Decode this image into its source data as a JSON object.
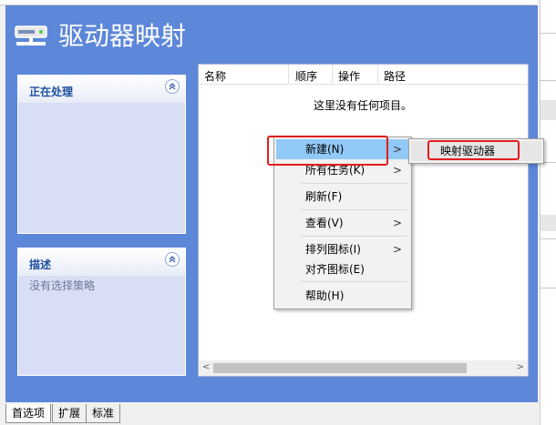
{
  "header": {
    "title": "驱动器映射"
  },
  "panels": {
    "processing": {
      "title": "正在处理"
    },
    "description": {
      "title": "描述",
      "text": "没有选择策略"
    }
  },
  "list": {
    "columns": [
      "名称",
      "顺序",
      "操作",
      "路径"
    ],
    "empty_message": "这里没有任何项目。"
  },
  "context_menu": {
    "items": [
      {
        "label": "新建(N)",
        "has_submenu": true,
        "highlighted": true
      },
      {
        "label": "所有任务(K)",
        "has_submenu": true
      },
      {
        "label": "刷新(F)"
      },
      {
        "label": "查看(V)",
        "has_submenu": true
      },
      {
        "label": "排列图标(I)",
        "has_submenu": true
      },
      {
        "label": "对齐图标(E)"
      },
      {
        "label": "帮助(H)"
      }
    ],
    "submenu_arrow": ">"
  },
  "submenu": {
    "items": [
      {
        "label": "映射驱动器"
      }
    ]
  },
  "scrollbar": {
    "left_arrow": "<",
    "right_arrow": ">"
  },
  "tabs": [
    {
      "label": "首选项",
      "active": true
    },
    {
      "label": "扩展"
    },
    {
      "label": "标准"
    }
  ],
  "colors": {
    "background_blue": "#5d87d9",
    "highlight": "#91c9f7",
    "annotation_red": "#e21d1d"
  }
}
